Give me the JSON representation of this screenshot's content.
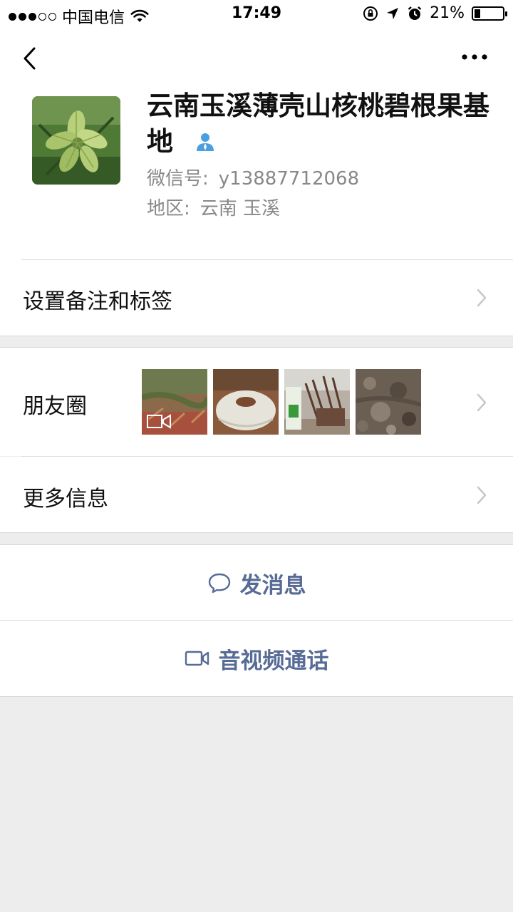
{
  "status_bar": {
    "carrier": "中国电信",
    "time": "17:49",
    "battery_percent": "21%",
    "battery_level": 0.21,
    "signal_bars_filled": 3,
    "signal_bars_total": 5
  },
  "profile": {
    "name": "云南玉溪薄壳山核桃碧根果基地",
    "wechat_id_label": "微信号:",
    "wechat_id": "y13887712068",
    "region_label": "地区:",
    "region": "云南 玉溪",
    "verify_icon": "person-verified-icon"
  },
  "rows": {
    "remark_label": "设置备注和标签",
    "moments_label": "朋友圈",
    "more_info_label": "更多信息"
  },
  "actions": {
    "message_label": "发消息",
    "call_label": "音视频通话"
  },
  "colors": {
    "link_blue": "#576b95",
    "verify_blue": "#4a9fe0",
    "background": "#ededed"
  }
}
